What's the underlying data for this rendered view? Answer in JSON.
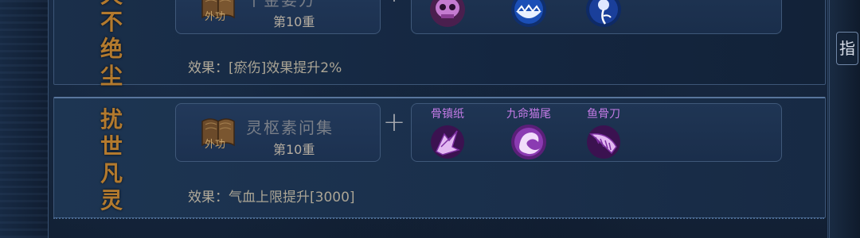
{
  "sections": [
    {
      "title": "天不绝尘",
      "title_chars": [
        "天",
        "不",
        "绝",
        "尘"
      ],
      "book": {
        "name": "千金要方",
        "type_label": "外功",
        "level": "第10重"
      },
      "items": [
        {
          "label": "",
          "icon": "skull-orb-icon"
        },
        {
          "label": "",
          "icon": "cracked-egg-orb-icon"
        },
        {
          "label": "",
          "icon": "flower-orb-icon"
        }
      ],
      "effect_prefix": "效果：",
      "effect_text": "[瘀伤]效果提升2%"
    },
    {
      "title": "扰世凡灵",
      "title_chars": [
        "扰",
        "世",
        "凡",
        "灵"
      ],
      "book": {
        "name": "灵枢素问集",
        "type_label": "外功",
        "level": "第10重"
      },
      "items": [
        {
          "label": "骨镇纸",
          "icon": "bone-paperweight-icon"
        },
        {
          "label": "九命猫尾",
          "icon": "cat-tail-icon"
        },
        {
          "label": "鱼骨刀",
          "icon": "fishbone-blade-icon"
        }
      ],
      "effect_prefix": "效果：",
      "effect_text": "气血上限提升[3000]"
    }
  ],
  "plus_symbol": "+",
  "side_glyph": "指",
  "colors": {
    "accent_gold": "#b37a2e",
    "item_purple": "#c37be6",
    "panel_bg": "#1d3552",
    "border": "#3d5677"
  }
}
